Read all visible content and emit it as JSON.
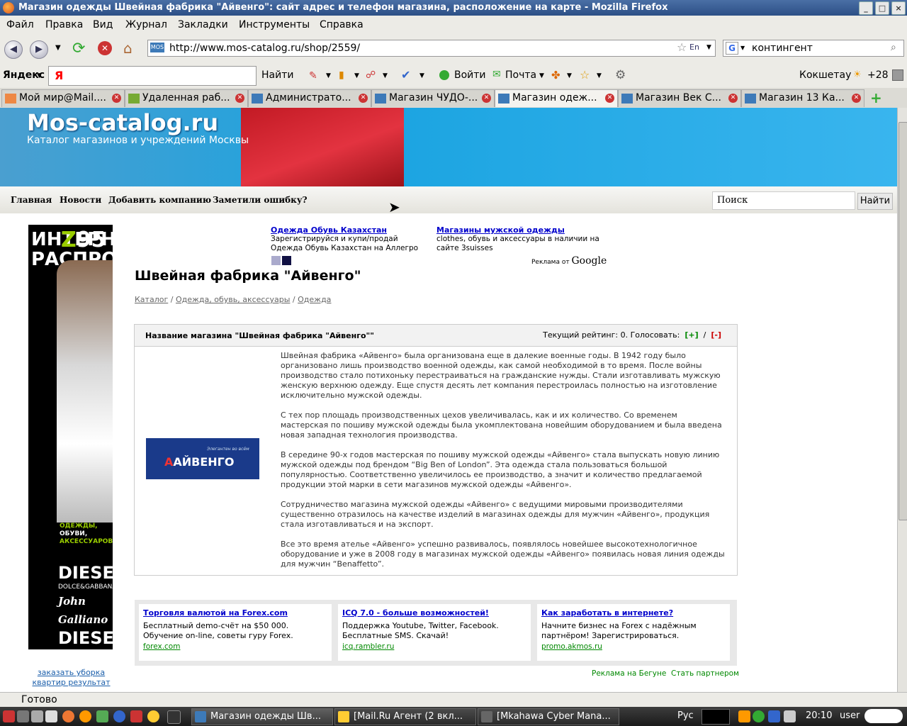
{
  "window": {
    "title": "Магазин одежды Швейная фабрика \"Айвенго\": сайт адрес и телефон магазина, расположение на карте - Mozilla Firefox"
  },
  "menu": [
    "Файл",
    "Правка",
    "Вид",
    "Журнал",
    "Закладки",
    "Инструменты",
    "Справка"
  ],
  "navbar": {
    "url": "http://www.mos-catalog.ru/shop/2559/",
    "lang": "En",
    "search_value": "контингент"
  },
  "yandex_bar": {
    "brand": "Яндекс",
    "input_logo": "Я",
    "find": "Найти",
    "login": "Войти",
    "mail": "Почта",
    "weather_city": "Кокшетау",
    "weather_temp": "+28"
  },
  "tabs": [
    {
      "label": "Мой мир@Mail...."
    },
    {
      "label": "Удаленная раб..."
    },
    {
      "label": "Администрато..."
    },
    {
      "label": "Магазин ЧУДО-..."
    },
    {
      "label": "Магазин одеж..."
    },
    {
      "label": "Магазин Век С..."
    },
    {
      "label": "Магазин 13 Ка..."
    }
  ],
  "site": {
    "logo": "Mos-catalog.ru",
    "tagline": "Каталог магазинов и учреждений Москвы",
    "nav": [
      "Главная",
      "Новости",
      "Добавить компанию",
      "Заметили ошибку?"
    ],
    "search_placeholder": "Поиск",
    "search_button": "Найти"
  },
  "left_ad": {
    "vertical_text": "ИНТЕРНЕТ-РАСПРОДАЖА",
    "brand_z": "Z",
    "brand_num": "95",
    "line1": "ОДЕЖДЫ,",
    "line2": "ОБУВИ,",
    "line3": "АКСЕССУАРОВ.",
    "brand1": "DIESEL",
    "brand2": "DOLCE&GABBANA",
    "brand3": "John Galliano",
    "brand4": "DIESEL"
  },
  "left_link": "заказать уборка квартир результат",
  "top_ads": [
    {
      "title": "Одежда Обувь Казахстан",
      "text": "Зарегистрируйся и купи/продай Одежда Обувь Казахстан на Аллегро"
    },
    {
      "title": "Магазины мужской одежды",
      "text": "clothes, обувь и аксессуары в наличии на сайте 3suisses"
    }
  ],
  "google_ads_label": "Реклама от",
  "google_word": "Google",
  "page_title": "Швейная фабрика \"Айвенго\"",
  "breadcrumbs": [
    "Каталог",
    "Одежда, обувь, аксессуары",
    "Одежда"
  ],
  "shop_box": {
    "name_label": "Название магазина \"Швейная фабрика \"Айвенго\"\"",
    "rating_label": "Текущий рейтинг:",
    "rating_value": "0",
    "vote_label": ". Голосовать:",
    "plus": "[+]",
    "slash": "/",
    "minus": "[-]",
    "logo_slogan": "Элегантен во всём",
    "logo_text": "АЙВЕНГО",
    "paragraphs": [
      "Швейная фабрика «Айвенго» была организована еще в далекие военные годы. В 1942 году было организовано лишь производство военной одежды, как самой необходимой в то время. После войны производство стало потихоньку перестраиваться на гражданские нужды. Стали изготавливать мужскую женскую верхнюю одежду. Еще спустя десять лет компания перестроилась полностью на изготовление исключительно мужской одежды.",
      "С тех пор площадь производственных цехов увеличивалась, как и их количество. Со временем мастерская по пошиву мужской одежды была укомплектована новейшим оборудованием и была введена новая западная технология производства.",
      "В середине 90-х годов мастерская по пошиву мужской одежды «Айвенго» стала выпускать новую линию мужской одежды под брендом “Big Ben of London”. Эта одежда стала пользоваться большой популярностью. Соответственно увеличилось ее производство, а значит и количество предлагаемой продукции этой марки в сети магазинов мужской одежды «Айвенго».",
      "Сотрудничество магазина мужской одежды «Айвенго» с ведущими мировыми производителями существенно отразилось на качестве изделий в магазинах одежды для мужчин «Айвенго», продукция стала изготавливаться и на экспорт.",
      "Все это время ателье «Айвенго» успешно развивалось, появлялось новейшее высокотехнологичное оборудование и уже в 2008 году в магазинах мужской одежды «Айвенго» появилась новая линия одежды для мужчин “Benaffetto”."
    ]
  },
  "bottom_ads": [
    {
      "title": "Торговля валютой на Forex.com",
      "text": "Бесплатный demo-счёт на $50 000. Обучение on-line, советы гуру Forex.",
      "url": "forex.com"
    },
    {
      "title": "ICQ 7.0 - больше возможностей!",
      "text": "Поддержка Youtube, Twitter, Facebook. Бесплатные SMS. Скачай!",
      "url": "icq.rambler.ru"
    },
    {
      "title": "Как заработать в интернете?",
      "text": "Начните бизнес на Forex с надёжным партнёром! Зарегистрироваться.",
      "url": "promo.akmos.ru"
    }
  ],
  "begun_text": "Реклама на Бегуне",
  "begun_partner": "Стать партнером",
  "status": "Готово",
  "taskbar": {
    "tasks": [
      {
        "label": "Магазин одежды Шв..."
      },
      {
        "label": "[Mail.Ru Агент (2 вкл..."
      },
      {
        "label": "[Mkahawa Cyber Mana..."
      }
    ],
    "lang": "Рус",
    "time": "20:10",
    "user": "user"
  }
}
